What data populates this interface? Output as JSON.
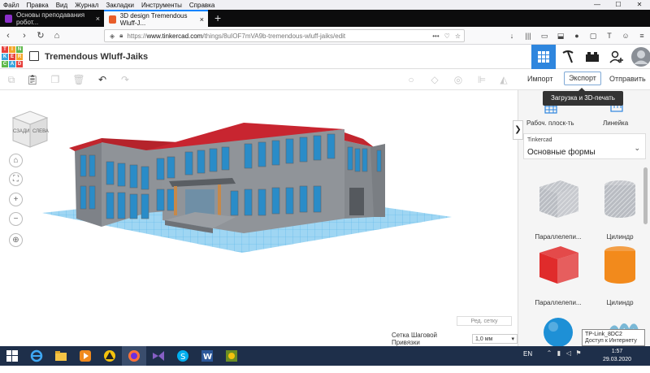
{
  "menu": [
    "Файл",
    "Правка",
    "Вид",
    "Журнал",
    "Закладки",
    "Инструменты",
    "Справка"
  ],
  "window_controls": [
    "—",
    "☐",
    "✕"
  ],
  "tabs": [
    {
      "title": "Основы преподавания робот...",
      "active": false,
      "favicon_color": "#8b2fc9"
    },
    {
      "title": "3D design Tremendous Wluff-J...",
      "active": true,
      "favicon_color": "#e85d2a"
    }
  ],
  "new_tab": "+",
  "url": {
    "scheme": "https://",
    "host": "www.tinkercad.com",
    "path": "/things/8uIOF7mVA9b-tremendous-wluff-jaiks/edit"
  },
  "url_actions": [
    "•••",
    "♡",
    "☆"
  ],
  "nav_extras": [
    "↓",
    "|||",
    "▭",
    "⬓",
    "●",
    "▢",
    "T",
    "☺",
    "≡"
  ],
  "logo_letters": [
    "T",
    "I",
    "N",
    "K",
    "E",
    "R",
    "C",
    "A",
    "D"
  ],
  "logo_colors": [
    "#e7403c",
    "#f4a62a",
    "#5eb84a",
    "#3aa6dd",
    "#e7403c",
    "#f4a62a",
    "#5eb84a",
    "#3aa6dd",
    "#e7403c"
  ],
  "design_title": "Tremendous Wluff-Jaiks",
  "header_icons": [
    "grid-icon",
    "pickaxe-icon",
    "bricks-icon",
    "add-user-icon",
    "avatar"
  ],
  "toolbar": {
    "import": "Импорт",
    "export": "Экспорт",
    "send": "Отправить"
  },
  "tooltip": "Загрузка и 3D-печать",
  "viewcube": {
    "left": "СЗАДИ",
    "right": "СЛЕВА"
  },
  "left_tools": [
    "home-icon",
    "fit-icon",
    "zoom-in-icon",
    "zoom-out-icon",
    "perspective-icon"
  ],
  "panel": {
    "workplane": "Рабоч. плоск-ть",
    "ruler": "Линейка",
    "library_source": "Tinkercad",
    "library_name": "Основные формы",
    "shapes": [
      {
        "label": "Параллелепи...",
        "kind": "box",
        "color": "#b9bcc2",
        "striped": true
      },
      {
        "label": "Цилиндр",
        "kind": "cylinder",
        "color": "#b9bcc2",
        "striped": true
      },
      {
        "label": "Параллелепи...",
        "kind": "box",
        "color": "#e02b2b",
        "striped": false
      },
      {
        "label": "Цилиндр",
        "kind": "cylinder",
        "color": "#f28a1c",
        "striped": false
      },
      {
        "label": "",
        "kind": "sphere",
        "color": "#1e90d6",
        "striped": false
      },
      {
        "label": "",
        "kind": "scribble",
        "color": "#7ab8d6",
        "striped": false
      }
    ]
  },
  "edit_grid": "Ред. сетку",
  "snap_label": "Сетка Шаговой Привязки",
  "snap_value": "1,0 мм",
  "network_tooltip": {
    "name": "TP-Link_8DC2",
    "status": "Доступ к Интернету"
  },
  "taskbar": {
    "lang": "EN",
    "time": "1:57",
    "date": "29.03.2020"
  }
}
